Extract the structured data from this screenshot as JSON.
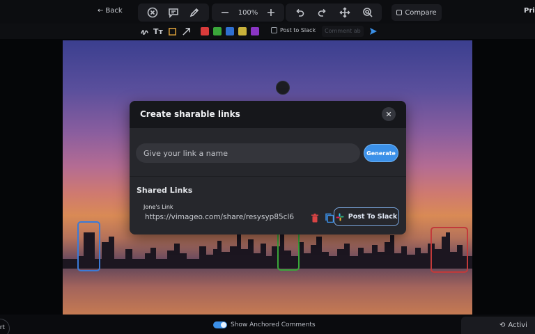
{
  "topbar": {
    "back_label": "Back",
    "zoom_level": "100%",
    "compare_label": "Compare",
    "right_label": "Pri"
  },
  "annotation_bar": {
    "post_to_slack_label": "Post to Slack",
    "comment_placeholder": "Comment ab",
    "colors": [
      "#d93b3b",
      "#3aa63a",
      "#2f6fd0",
      "#c9b23b",
      "#8a35c4"
    ]
  },
  "modal": {
    "title": "Create sharable links",
    "close_icon": "close-icon",
    "name_placeholder": "Give your link a name",
    "generate_label": "Generate",
    "shared_title": "Shared Links",
    "links": [
      {
        "name": "Jone's Link",
        "url": "https://vimageo.com/share/resysyp85cl6",
        "slack_label": "Post To Slack"
      }
    ]
  },
  "bottombar": {
    "left_label": "rt",
    "anchored_label": "Show Anchored Comments",
    "activity_label": "Activi"
  },
  "accent_color": "#3b90e8"
}
